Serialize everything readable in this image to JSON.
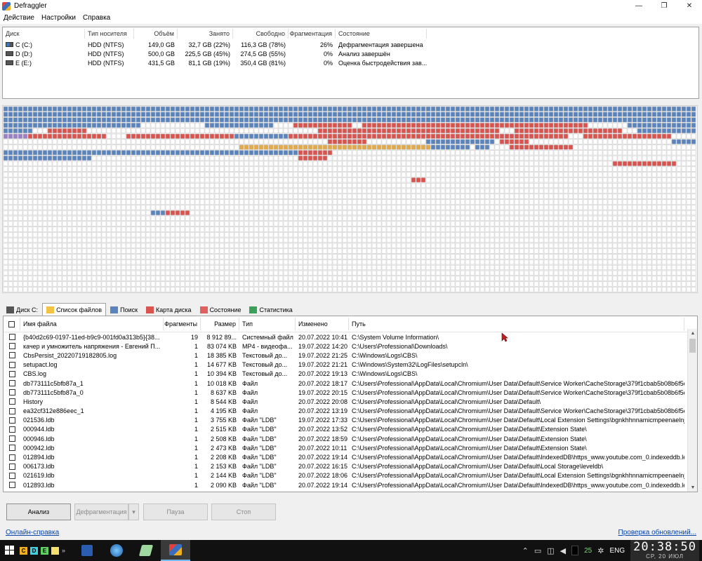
{
  "window": {
    "title": "Defraggler",
    "controls": [
      "—",
      "❐",
      "✕"
    ]
  },
  "menu": [
    "Действие",
    "Настройки",
    "Справка"
  ],
  "drive_list": {
    "headers": {
      "disk": "Диск",
      "media": "Тип носителя",
      "size": "Объём",
      "used": "Занято",
      "free": "Свободно",
      "frag": "Фрагментация",
      "state": "Состояние"
    },
    "rows": [
      {
        "disk": "C (C:)",
        "media": "HDD (NTFS)",
        "size": "149,0 GB",
        "used": "32,7 GB (22%)",
        "free": "116,3 GB (78%)",
        "frag": "26%",
        "state": "Дефрагментация завершена",
        "icon": "system-drive-icon"
      },
      {
        "disk": "D (D:)",
        "media": "HDD (NTFS)",
        "size": "500,0 GB",
        "used": "225,5 GB (45%)",
        "free": "274,5 GB (55%)",
        "frag": "0%",
        "state": "Анализ завершён",
        "icon": "drive-icon"
      },
      {
        "disk": "E (E:)",
        "media": "HDD (NTFS)",
        "size": "431,5 GB",
        "used": "81,1 GB (19%)",
        "free": "350,4 GB (81%)",
        "frag": "0%",
        "state": "Оценка быстродействия зав...",
        "icon": "drive-icon"
      }
    ]
  },
  "disk_map": {
    "colors": {
      "free": "#ffffff",
      "used": "#5b84bd",
      "fragmented": "#d9534f",
      "unmovable": "#e0a94a",
      "mft": "#9b7fc4",
      "border": "#c8c8c8"
    }
  },
  "tabs": [
    {
      "label": "Диск C:",
      "icon": "drive-icon",
      "active": false
    },
    {
      "label": "Список файлов",
      "icon": "folder-icon",
      "active": true
    },
    {
      "label": "Поиск",
      "icon": "search-icon",
      "active": false
    },
    {
      "label": "Карта диска",
      "icon": "map-icon",
      "active": false
    },
    {
      "label": "Состояние",
      "icon": "health-icon",
      "active": false
    },
    {
      "label": "Статистика",
      "icon": "chart-icon",
      "active": false
    }
  ],
  "file_list": {
    "headers": {
      "name": "Имя файла",
      "frag": "Фрагменты",
      "size": "Размер",
      "type": "Тип",
      "modified": "Изменено",
      "path": "Путь"
    },
    "rows": [
      {
        "name": "{b40d2c69-0197-11ed-b9c9-001fd0a313b5}{38...",
        "frag": "19",
        "size": "8 912 89...",
        "type": "Системный файл",
        "modified": "20.07.2022 10:41",
        "path": "C:\\System Volume Information\\"
      },
      {
        "name": "качер и умножитель напряжения - Евгений П...",
        "frag": "1",
        "size": "83 074 KB",
        "type": "MP4 - видеофа...",
        "modified": "19.07.2022 14:20",
        "path": "C:\\Users\\Professional\\Downloads\\"
      },
      {
        "name": "CbsPersist_20220719182805.log",
        "frag": "1",
        "size": "18 385 KB",
        "type": "Текстовый до...",
        "modified": "19.07.2022 21:25",
        "path": "C:\\Windows\\Logs\\CBS\\"
      },
      {
        "name": "setupact.log",
        "frag": "1",
        "size": "14 677 KB",
        "type": "Текстовый до...",
        "modified": "19.07.2022 21:21",
        "path": "C:\\Windows\\System32\\LogFiles\\setupcln\\"
      },
      {
        "name": "CBS.log",
        "frag": "1",
        "size": "10 394 KB",
        "type": "Текстовый до...",
        "modified": "20.07.2022 19:13",
        "path": "C:\\Windows\\Logs\\CBS\\"
      },
      {
        "name": "db773111c5bfb87a_1",
        "frag": "1",
        "size": "10 018 KB",
        "type": "Файл",
        "modified": "20.07.2022 18:17",
        "path": "C:\\Users\\Professional\\AppData\\Local\\Chromium\\User Data\\Default\\Service Worker\\CacheStorage\\379f1cbab5b08b6f5e0..."
      },
      {
        "name": "db773111c5bfb87a_0",
        "frag": "1",
        "size": "8 637 KB",
        "type": "Файл",
        "modified": "19.07.2022 20:15",
        "path": "C:\\Users\\Professional\\AppData\\Local\\Chromium\\User Data\\Default\\Service Worker\\CacheStorage\\379f1cbab5b08b6f5e0..."
      },
      {
        "name": "History",
        "frag": "1",
        "size": "8 544 KB",
        "type": "Файл",
        "modified": "20.07.2022 20:08",
        "path": "C:\\Users\\Professional\\AppData\\Local\\Chromium\\User Data\\Default\\"
      },
      {
        "name": "ea32cf312e886eec_1",
        "frag": "1",
        "size": "4 195 KB",
        "type": "Файл",
        "modified": "20.07.2022 13:19",
        "path": "C:\\Users\\Professional\\AppData\\Local\\Chromium\\User Data\\Default\\Service Worker\\CacheStorage\\379f1cbab5b08b6f5e0..."
      },
      {
        "name": "021536.ldb",
        "frag": "1",
        "size": "3 755 KB",
        "type": "Файл \"LDB\"",
        "modified": "19.07.2022 17:33",
        "path": "C:\\Users\\Professional\\AppData\\Local\\Chromium\\User Data\\Default\\Local Extension Settings\\bgnkhhnnamicmpeenaelnjfhik..."
      },
      {
        "name": "000944.ldb",
        "frag": "1",
        "size": "2 515 KB",
        "type": "Файл \"LDB\"",
        "modified": "20.07.2022 13:52",
        "path": "C:\\Users\\Professional\\AppData\\Local\\Chromium\\User Data\\Default\\Extension State\\"
      },
      {
        "name": "000946.ldb",
        "frag": "1",
        "size": "2 508 KB",
        "type": "Файл \"LDB\"",
        "modified": "20.07.2022 18:59",
        "path": "C:\\Users\\Professional\\AppData\\Local\\Chromium\\User Data\\Default\\Extension State\\"
      },
      {
        "name": "000942.ldb",
        "frag": "1",
        "size": "2 473 KB",
        "type": "Файл \"LDB\"",
        "modified": "20.07.2022 10:11",
        "path": "C:\\Users\\Professional\\AppData\\Local\\Chromium\\User Data\\Default\\Extension State\\"
      },
      {
        "name": "012894.ldb",
        "frag": "1",
        "size": "2 208 KB",
        "type": "Файл \"LDB\"",
        "modified": "20.07.2022 19:14",
        "path": "C:\\Users\\Professional\\AppData\\Local\\Chromium\\User Data\\Default\\IndexedDB\\https_www.youtube.com_0.indexeddb.lev..."
      },
      {
        "name": "006173.ldb",
        "frag": "1",
        "size": "2 153 KB",
        "type": "Файл \"LDB\"",
        "modified": "20.07.2022 16:15",
        "path": "C:\\Users\\Professional\\AppData\\Local\\Chromium\\User Data\\Default\\Local Storage\\leveldb\\"
      },
      {
        "name": "021619.ldb",
        "frag": "1",
        "size": "2 144 KB",
        "type": "Файл \"LDB\"",
        "modified": "20.07.2022 18:06",
        "path": "C:\\Users\\Professional\\AppData\\Local\\Chromium\\User Data\\Default\\Local Extension Settings\\bgnkhhnnamicmpeenaelnjfhik..."
      },
      {
        "name": "012893.ldb",
        "frag": "1",
        "size": "2 090 KB",
        "type": "Файл \"LDB\"",
        "modified": "20.07.2022 19:14",
        "path": "C:\\Users\\Professional\\AppData\\Local\\Chromium\\User Data\\Default\\IndexedDB\\https_www.youtube.com_0.indexeddb.lev..."
      }
    ]
  },
  "buttons": {
    "analyze": "Анализ",
    "defrag": "Дефрагментация",
    "defrag_drop": "▾",
    "pause": "Пауза",
    "stop": "Стоп"
  },
  "links": {
    "help": "Онлайн-справка",
    "update": "Проверка обновлений..."
  },
  "taskbar": {
    "quicklaunch": [
      "C",
      "D",
      "E"
    ],
    "tray_number": "25",
    "language": "ENG",
    "time": "20:38:50",
    "date": "СР, 20 ИЮЛ"
  }
}
